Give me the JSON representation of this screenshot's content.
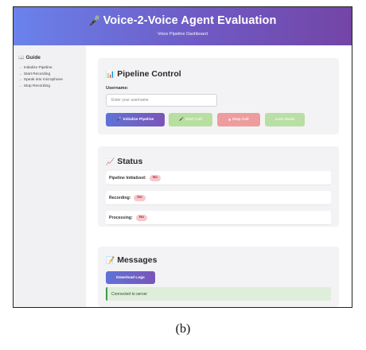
{
  "header": {
    "title": "Voice-2-Voice Agent Evaluation",
    "subtitle": "Voice Pipeline Dashboard",
    "accent_start": "#6a82ec",
    "accent_end": "#7345a6"
  },
  "sidebar": {
    "title": "Guide",
    "items": [
      {
        "label": "Initialize Pipeline"
      },
      {
        "label": "Start Recording"
      },
      {
        "label": "Speak into microphone"
      },
      {
        "label": "Stop Recording"
      }
    ]
  },
  "pipeline": {
    "title": "Pipeline Control",
    "username_label": "Username:",
    "username_value": "",
    "username_placeholder": "Enter your username",
    "buttons": {
      "init": "Initialize Pipeline",
      "start": "Start Call",
      "stop": "Stop Call",
      "auto": "Auto Mode"
    }
  },
  "status": {
    "title": "Status",
    "rows": [
      {
        "label": "Pipeline Initialized:",
        "value": "No"
      },
      {
        "label": "Recording:",
        "value": "No"
      },
      {
        "label": "Processing:",
        "value": "No"
      }
    ]
  },
  "messages": {
    "title": "Messages",
    "download_label": "Download Logs",
    "log": "Connected to server"
  },
  "caption": "(b)",
  "icons": {
    "header": "microphone-icon",
    "sidebar": "book-icon",
    "pipeline": "bar-chart-icon",
    "status": "line-chart-icon",
    "messages": "memo-icon"
  }
}
